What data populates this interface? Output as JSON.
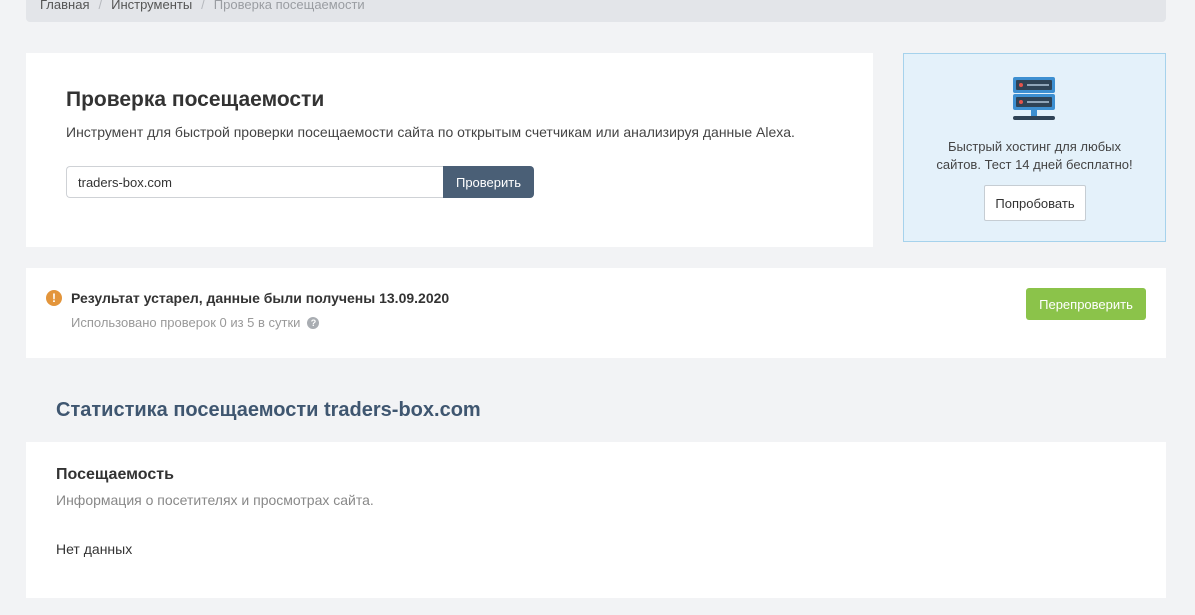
{
  "breadcrumb": {
    "items": [
      "Главная",
      "Инструменты"
    ],
    "current": "Проверка посещаемости",
    "separator": "/"
  },
  "tool": {
    "title": "Проверка посещаемости",
    "description": "Инструмент для быстрой проверки посещаемости сайта по открытым счетчикам или анализируя данные Alexa.",
    "input_value": "traders-box.com",
    "button_label": "Проверить"
  },
  "promo": {
    "icon": "server-icon",
    "text_line1": "Быстрый хостинг для любых",
    "text_line2": "сайтов. Тест 14 дней бесплатно!",
    "button_label": "Попробовать"
  },
  "result": {
    "icon": "warning-icon",
    "title": "Результат устарел, данные были получены 13.09.2020",
    "usage": "Использовано проверок 0 из 5 в сутки",
    "help_icon": "?",
    "button_label": "Перепроверить"
  },
  "stats": {
    "heading": "Статистика посещаемости traders-box.com"
  },
  "visits": {
    "title": "Посещаемость",
    "description": "Информация о посетителях и просмотрах сайта.",
    "empty_text": "Нет данных"
  },
  "colors": {
    "page_bg": "#f2f3f5",
    "primary_button": "#4a5f76",
    "recheck_button": "#8bc34a",
    "promo_bg": "#e4f1fa",
    "promo_border": "#a6d2ec",
    "warning": "#e3953b",
    "heading_blue": "#3f5670"
  }
}
